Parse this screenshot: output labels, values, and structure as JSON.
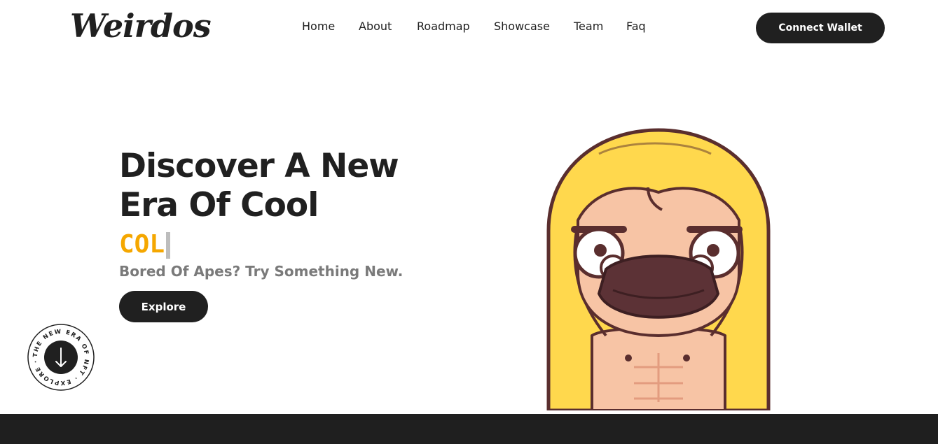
{
  "brand": {
    "logo_text": "Weirdos"
  },
  "nav": {
    "items": [
      {
        "label": "Home"
      },
      {
        "label": "About"
      },
      {
        "label": "Roadmap"
      },
      {
        "label": "Showcase"
      },
      {
        "label": "Team"
      },
      {
        "label": "Faq"
      }
    ]
  },
  "header": {
    "connect_label": "Connect Wallet"
  },
  "hero": {
    "title_line1": "Discover A New",
    "title_line2": "Era Of Cool",
    "typed_text": "COL",
    "subtitle": "Bored Of Apes? Try Something New.",
    "explore_label": "Explore"
  },
  "badge": {
    "circular_text": "THE NEW ERA OF NFT · EXPLORE ·",
    "icon": "arrow-down-icon"
  },
  "colors": {
    "accent": "#f5a700",
    "dark": "#202020",
    "hair": "#ffd84d",
    "outline": "#5a2e2e"
  }
}
